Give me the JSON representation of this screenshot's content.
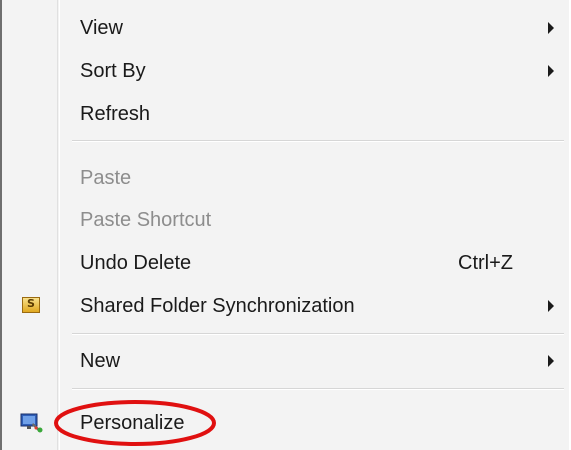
{
  "context_menu": {
    "items": [
      {
        "label": "View",
        "has_submenu": true
      },
      {
        "label": "Sort By",
        "has_submenu": true
      },
      {
        "label": "Refresh"
      },
      {
        "label": "Paste",
        "disabled": true
      },
      {
        "label": "Paste Shortcut",
        "disabled": true
      },
      {
        "label": "Undo Delete",
        "shortcut": "Ctrl+Z"
      },
      {
        "label": "Shared Folder Synchronization",
        "has_submenu": true,
        "icon": "shared-folder-sync-icon"
      },
      {
        "label": "New",
        "has_submenu": true
      },
      {
        "label": "Personalize",
        "icon": "personalize-display-icon"
      }
    ]
  },
  "annotation": {
    "circled_item": "Personalize",
    "color": "#e01010"
  },
  "colors": {
    "menu_background": "#f3f3f3",
    "disabled_text": "#8d8d8d",
    "text": "#1a1a1a"
  }
}
